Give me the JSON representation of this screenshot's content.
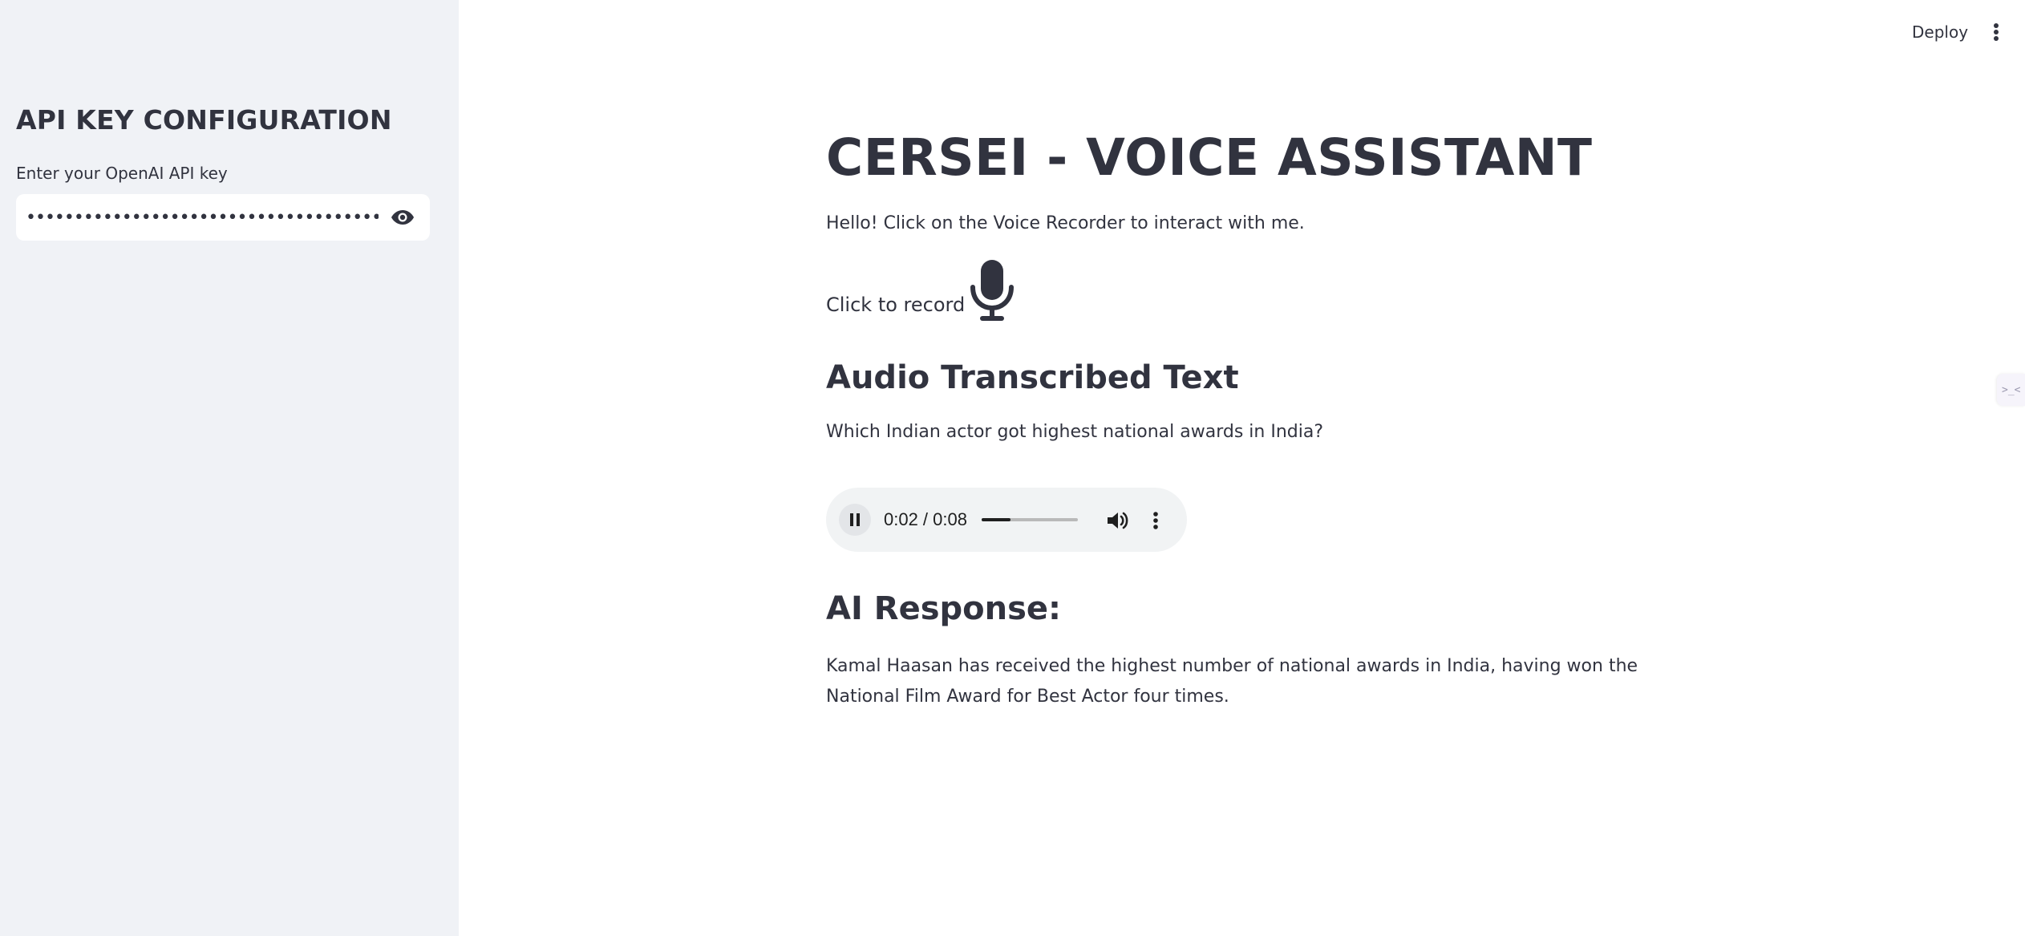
{
  "sidebar": {
    "title": "API KEY CONFIGURATION",
    "api_key_label": "Enter your OpenAI API key",
    "api_key_value": "••••••••••••••••••••••••••••••••••••••••••••••••••••••"
  },
  "header": {
    "deploy_label": "Deploy",
    "side_tab_text": ">_<"
  },
  "main": {
    "title": "CERSEI - VOICE ASSISTANT",
    "intro": "Hello! Click on the Voice Recorder to interact with me.",
    "record_label": "Click to record",
    "transcribed_heading": "Audio Transcribed Text",
    "transcribed_text": "Which Indian actor got highest national awards in India?",
    "response_heading": "AI Response:",
    "response_text": "Kamal Haasan has received the highest number of national awards in India, having won the National Film Award for Best Actor four times."
  },
  "audio_player": {
    "time": "0:02 / 0:08",
    "progress_fraction": 0.3
  },
  "icons": {
    "eye": "eye-icon",
    "menu": "vertical-dots-icon",
    "mic": "microphone-icon",
    "pause": "pause-icon",
    "volume": "volume-icon",
    "player_menu": "vertical-dots-icon"
  },
  "colors": {
    "sidebar_bg": "#f0f2f6",
    "text": "#31333f",
    "player_bg": "#f1f3f4"
  }
}
